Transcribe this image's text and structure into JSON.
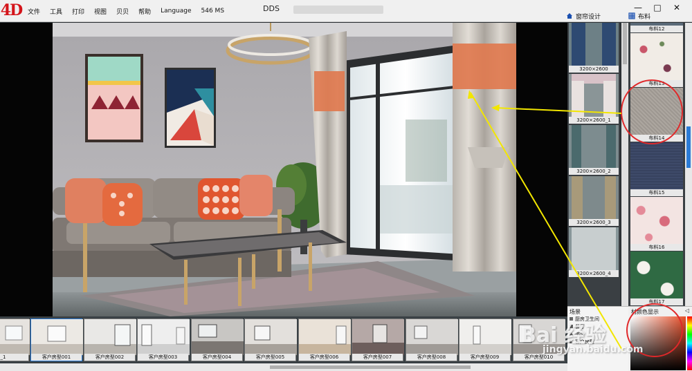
{
  "app": {
    "logo": "4D",
    "title": "DDS"
  },
  "menu": [
    {
      "label": "文件"
    },
    {
      "label": "工具"
    },
    {
      "label": "打印"
    },
    {
      "label": "视图"
    },
    {
      "label": "贝贝"
    },
    {
      "label": "帮助"
    },
    {
      "label": "Language"
    },
    {
      "label": "546 MS"
    }
  ],
  "window_controls": {
    "minimize": "—",
    "maximize": "□",
    "close": "✕"
  },
  "panel_tabs": {
    "curtain": "窗帘设计",
    "fabric": "布料"
  },
  "curtain_designs": [
    {
      "label": "3200×2600"
    },
    {
      "label": "3200×2600_1"
    },
    {
      "label": "3200×2600_2"
    },
    {
      "label": "3200×2600_3"
    },
    {
      "label": "3200×2600_4"
    }
  ],
  "fabrics": [
    {
      "label": "布料12",
      "color": "#5a6a78"
    },
    {
      "label": "布料13",
      "color": "#f1ece6"
    },
    {
      "label": "布料14",
      "color": "#a49e98"
    },
    {
      "label": "布料15",
      "color": "#3a4563"
    },
    {
      "label": "布料16",
      "color": "#f3e4e2"
    },
    {
      "label": "布料17",
      "color": "#2f6a43"
    },
    {
      "label": "",
      "color": "#3e2f5a"
    }
  ],
  "color_display": {
    "title": "材颜色显示",
    "pin": "◁"
  },
  "room_list": {
    "header": "场景",
    "items": [
      "厨房卫生间",
      "餐厅",
      "书房",
      "客户房型"
    ]
  },
  "room_thumbs": [
    {
      "label": "_1"
    },
    {
      "label": "客户房型001"
    },
    {
      "label": "客户房型002"
    },
    {
      "label": "客户房型003"
    },
    {
      "label": "客户房型004"
    },
    {
      "label": "客户房型005"
    },
    {
      "label": "客户房型006"
    },
    {
      "label": "客户房型007"
    },
    {
      "label": "客户房型008"
    },
    {
      "label": "客户房型009"
    },
    {
      "label": "客户房型010"
    }
  ],
  "watermark": {
    "text": "Bai 经验",
    "url": "jingyan.baidu.com"
  },
  "colors": {
    "accent": "#2b7bd6",
    "annotation_red": "#e0282a",
    "annotation_yellow": "#f2e600"
  }
}
